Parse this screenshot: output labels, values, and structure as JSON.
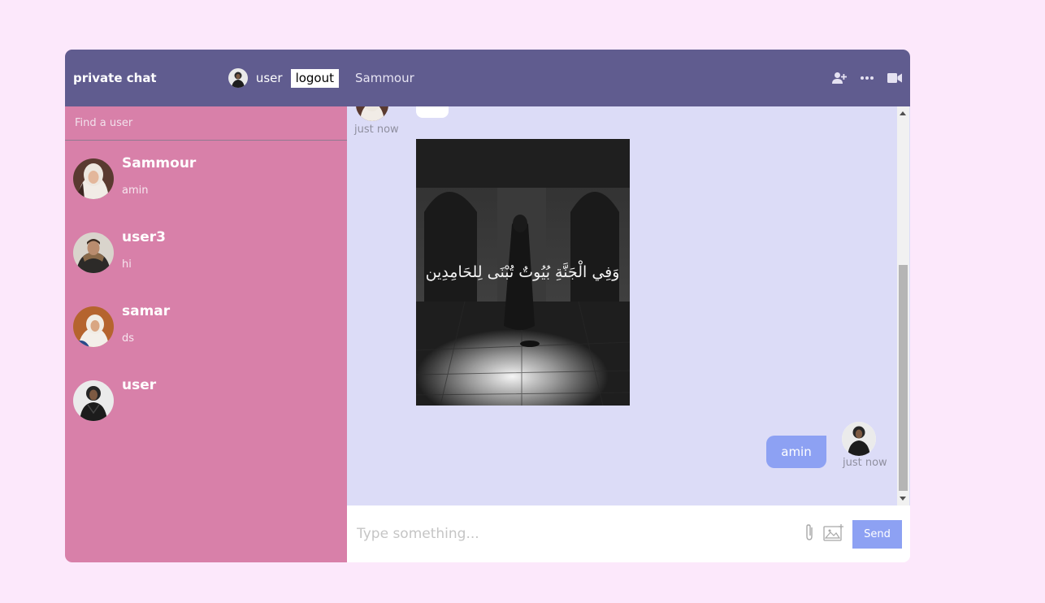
{
  "navbar": {
    "brand": "private chat",
    "current_user": {
      "name": "user",
      "avatar": "avatar-photo"
    },
    "logout_label": "logout"
  },
  "search": {
    "placeholder": "Find a user"
  },
  "chats": [
    {
      "name": "Sammour",
      "last_message": "amin"
    },
    {
      "name": "user3",
      "last_message": "hi"
    },
    {
      "name": "samar",
      "last_message": "ds"
    },
    {
      "name": "user",
      "last_message": ""
    }
  ],
  "chat_header": {
    "title": "Sammour",
    "icons": [
      "add-user-icon",
      "more-icon",
      "video-icon"
    ]
  },
  "messages": [
    {
      "owner": "other",
      "timestamp": "just now",
      "image_caption": "وَفِي الْجَنَّةِ بُيُوتٌ تُبْنَى لِلحَامِدِين"
    },
    {
      "owner": "self",
      "text": "amin",
      "timestamp": "just now"
    }
  ],
  "input": {
    "placeholder": "Type something...",
    "send_label": "Send"
  },
  "colors": {
    "page_bg": "#fce8fb",
    "sidebar_bg": "#d880a9",
    "header_bg": "#605c8f",
    "messages_bg": "#dcdcf7",
    "own_bubble": "#8da1f3"
  }
}
